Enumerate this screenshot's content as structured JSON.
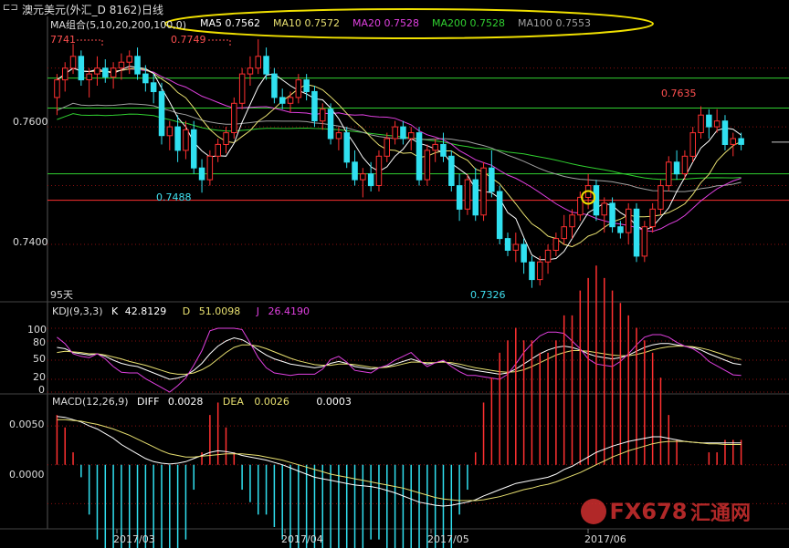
{
  "header": {
    "title": "澳元美元(外汇_D 8162)日线",
    "ma_group_label": "MA组合(5,10,20,200,100,0)",
    "ma_values": [
      {
        "name": "MA5",
        "value": "0.7562",
        "color": "#ffffff"
      },
      {
        "name": "MA10",
        "value": "0.7572",
        "color": "#e8e070"
      },
      {
        "name": "MA20",
        "value": "0.7528",
        "color": "#e040e0"
      },
      {
        "name": "MA200",
        "value": "0.7528",
        "color": "#30d030"
      },
      {
        "name": "MA100",
        "value": "0.7553",
        "color": "#a0a0a0"
      }
    ]
  },
  "annotations": {
    "high1": "7741",
    "high2": "0.7749",
    "low1": "0.7488",
    "low2": "0.7326",
    "high3": "0.7635",
    "days": "95天"
  },
  "kdj": {
    "label": "KDJ(9,3,3)",
    "k_label": "K",
    "k_value": "42.8129",
    "d_label": "D",
    "d_value": "51.0098",
    "j_label": "J",
    "j_value": "26.4190",
    "ticks": [
      "100",
      "80",
      "50",
      "20",
      "0"
    ]
  },
  "macd": {
    "label": "MACD(12,26,9)",
    "diff_label": "DIFF",
    "diff_value": "0.0028",
    "dea_label": "DEA",
    "dea_value": "0.0026",
    "macd_value": "0.0003",
    "ticks": [
      "0.0050",
      "0.0000"
    ]
  },
  "price_axis": {
    "ticks": [
      "0.7600",
      "0.7400"
    ]
  },
  "time_axis": {
    "labels": [
      "2017/03",
      "2017/04",
      "2017/05",
      "2017/06"
    ]
  },
  "watermark": {
    "text": "FX678",
    "text2": "汇通网"
  },
  "colors": {
    "up": "#ff3030",
    "down": "#30e0f0",
    "ma5": "#ffffff",
    "ma10": "#e8e070",
    "ma20": "#e040e0",
    "ma200": "#30d030",
    "ma100": "#a0a0a0",
    "hline": "#30d030",
    "grid_red": "#8a1010"
  },
  "chart_data": [
    {
      "type": "candlestick",
      "title": "澳元美元(外汇_D 8162)日线",
      "ylim": [
        0.731,
        0.776
      ],
      "yticks": [
        0.74,
        0.76
      ],
      "x_labels": [
        "2017/03",
        "2017/04",
        "2017/05",
        "2017/06"
      ],
      "candles": [
        [
          0.765,
          0.769,
          0.762,
          0.768
        ],
        [
          0.768,
          0.771,
          0.766,
          0.77
        ],
        [
          0.77,
          0.7741,
          0.769,
          0.772
        ],
        [
          0.772,
          0.773,
          0.767,
          0.768
        ],
        [
          0.768,
          0.77,
          0.765,
          0.769
        ],
        [
          0.769,
          0.772,
          0.767,
          0.77
        ],
        [
          0.77,
          0.7715,
          0.7675,
          0.7685
        ],
        [
          0.7685,
          0.771,
          0.7665,
          0.77
        ],
        [
          0.77,
          0.7725,
          0.768,
          0.771
        ],
        [
          0.771,
          0.773,
          0.769,
          0.772
        ],
        [
          0.772,
          0.7735,
          0.768,
          0.769
        ],
        [
          0.769,
          0.7705,
          0.766,
          0.7675
        ],
        [
          0.7675,
          0.769,
          0.764,
          0.766
        ],
        [
          0.766,
          0.7675,
          0.757,
          0.7585
        ],
        [
          0.7585,
          0.761,
          0.756,
          0.76
        ],
        [
          0.76,
          0.762,
          0.754,
          0.756
        ],
        [
          0.756,
          0.761,
          0.7545,
          0.7595
        ],
        [
          0.7595,
          0.761,
          0.752,
          0.753
        ],
        [
          0.753,
          0.7545,
          0.7488,
          0.751
        ],
        [
          0.751,
          0.756,
          0.75,
          0.755
        ],
        [
          0.755,
          0.758,
          0.754,
          0.757
        ],
        [
          0.757,
          0.76,
          0.7555,
          0.759
        ],
        [
          0.759,
          0.765,
          0.758,
          0.764
        ],
        [
          0.764,
          0.77,
          0.763,
          0.769
        ],
        [
          0.769,
          0.772,
          0.767,
          0.77
        ],
        [
          0.77,
          0.7749,
          0.769,
          0.772
        ],
        [
          0.772,
          0.7735,
          0.768,
          0.769
        ],
        [
          0.769,
          0.77,
          0.764,
          0.765
        ],
        [
          0.765,
          0.7665,
          0.763,
          0.764
        ],
        [
          0.764,
          0.766,
          0.7625,
          0.765
        ],
        [
          0.765,
          0.769,
          0.764,
          0.768
        ],
        [
          0.768,
          0.769,
          0.7645,
          0.766
        ],
        [
          0.766,
          0.767,
          0.76,
          0.761
        ],
        [
          0.761,
          0.764,
          0.7595,
          0.763
        ],
        [
          0.763,
          0.764,
          0.757,
          0.758
        ],
        [
          0.758,
          0.76,
          0.756,
          0.759
        ],
        [
          0.759,
          0.76,
          0.753,
          0.754
        ],
        [
          0.754,
          0.756,
          0.75,
          0.751
        ],
        [
          0.751,
          0.753,
          0.748,
          0.752
        ],
        [
          0.752,
          0.754,
          0.749,
          0.75
        ],
        [
          0.75,
          0.756,
          0.749,
          0.755
        ],
        [
          0.755,
          0.759,
          0.754,
          0.758
        ],
        [
          0.758,
          0.761,
          0.757,
          0.76
        ],
        [
          0.76,
          0.761,
          0.757,
          0.758
        ],
        [
          0.758,
          0.76,
          0.756,
          0.759
        ],
        [
          0.759,
          0.76,
          0.75,
          0.751
        ],
        [
          0.751,
          0.757,
          0.75,
          0.756
        ],
        [
          0.756,
          0.758,
          0.754,
          0.757
        ],
        [
          0.757,
          0.759,
          0.754,
          0.755
        ],
        [
          0.755,
          0.756,
          0.749,
          0.75
        ],
        [
          0.75,
          0.752,
          0.744,
          0.746
        ],
        [
          0.746,
          0.752,
          0.745,
          0.751
        ],
        [
          0.751,
          0.753,
          0.744,
          0.745
        ],
        [
          0.745,
          0.754,
          0.744,
          0.753
        ],
        [
          0.753,
          0.756,
          0.748,
          0.749
        ],
        [
          0.749,
          0.75,
          0.74,
          0.741
        ],
        [
          0.741,
          0.742,
          0.738,
          0.739
        ],
        [
          0.739,
          0.742,
          0.737,
          0.74
        ],
        [
          0.74,
          0.741,
          0.735,
          0.737
        ],
        [
          0.737,
          0.738,
          0.7326,
          0.734
        ],
        [
          0.734,
          0.738,
          0.733,
          0.737
        ],
        [
          0.737,
          0.74,
          0.735,
          0.739
        ],
        [
          0.739,
          0.742,
          0.738,
          0.741
        ],
        [
          0.741,
          0.745,
          0.74,
          0.743
        ],
        [
          0.743,
          0.746,
          0.741,
          0.745
        ],
        [
          0.745,
          0.749,
          0.744,
          0.748
        ],
        [
          0.748,
          0.752,
          0.746,
          0.75
        ],
        [
          0.75,
          0.751,
          0.744,
          0.745
        ],
        [
          0.745,
          0.748,
          0.742,
          0.747
        ],
        [
          0.747,
          0.748,
          0.742,
          0.743
        ],
        [
          0.743,
          0.744,
          0.741,
          0.742
        ],
        [
          0.742,
          0.747,
          0.74,
          0.746
        ],
        [
          0.746,
          0.747,
          0.737,
          0.738
        ],
        [
          0.738,
          0.744,
          0.737,
          0.743
        ],
        [
          0.743,
          0.747,
          0.742,
          0.746
        ],
        [
          0.746,
          0.751,
          0.745,
          0.75
        ],
        [
          0.75,
          0.755,
          0.749,
          0.754
        ],
        [
          0.754,
          0.756,
          0.751,
          0.752
        ],
        [
          0.752,
          0.756,
          0.751,
          0.755
        ],
        [
          0.755,
          0.76,
          0.754,
          0.759
        ],
        [
          0.759,
          0.7635,
          0.758,
          0.762
        ],
        [
          0.762,
          0.763,
          0.758,
          0.76
        ],
        [
          0.76,
          0.763,
          0.759,
          0.761
        ],
        [
          0.761,
          0.762,
          0.756,
          0.757
        ],
        [
          0.757,
          0.759,
          0.755,
          0.758
        ],
        [
          0.758,
          0.759,
          0.756,
          0.757
        ]
      ]
    },
    {
      "type": "line",
      "title": "KDJ(9,3,3)",
      "ylim": [
        0,
        100
      ],
      "series": [
        {
          "name": "K",
          "values": [
            70,
            68,
            62,
            60,
            58,
            60,
            56,
            50,
            45,
            42,
            40,
            35,
            30,
            25,
            20,
            22,
            26,
            34,
            45,
            60,
            72,
            80,
            85,
            82,
            75,
            66,
            58,
            52,
            48,
            44,
            42,
            40,
            38,
            40,
            45,
            48,
            45,
            40,
            38,
            36,
            38,
            40,
            44,
            48,
            52,
            48,
            44,
            46,
            48,
            44,
            40,
            36,
            34,
            32,
            30,
            28,
            30,
            36,
            44,
            52,
            60,
            66,
            70,
            72,
            70,
            66,
            60,
            56,
            54,
            52,
            54,
            58,
            64,
            70,
            74,
            76,
            76,
            74,
            72,
            70,
            66,
            60,
            55,
            50,
            45,
            43
          ]
        },
        {
          "name": "D",
          "values": [
            62,
            64,
            63,
            62,
            60,
            60,
            58,
            55,
            52,
            48,
            45,
            42,
            38,
            34,
            30,
            28,
            28,
            30,
            35,
            42,
            52,
            62,
            70,
            74,
            74,
            72,
            68,
            63,
            58,
            53,
            49,
            46,
            43,
            42,
            42,
            44,
            44,
            43,
            41,
            39,
            38,
            39,
            41,
            44,
            47,
            47,
            46,
            46,
            47,
            46,
            44,
            41,
            38,
            36,
            34,
            32,
            31,
            32,
            35,
            40,
            46,
            52,
            58,
            62,
            65,
            65,
            64,
            62,
            60,
            58,
            57,
            57,
            59,
            62,
            66,
            69,
            71,
            72,
            72,
            71,
            69,
            66,
            62,
            58,
            54,
            51
          ]
        },
        {
          "name": "J",
          "values": [
            86,
            76,
            60,
            56,
            54,
            60,
            52,
            40,
            31,
            30,
            30,
            21,
            14,
            7,
            0,
            10,
            22,
            42,
            65,
            96,
            100,
            100,
            100,
            98,
            77,
            54,
            38,
            30,
            28,
            26,
            28,
            28,
            28,
            36,
            51,
            56,
            47,
            34,
            32,
            30,
            38,
            42,
            50,
            56,
            62,
            50,
            40,
            46,
            50,
            40,
            32,
            26,
            26,
            24,
            22,
            20,
            28,
            44,
            62,
            76,
            88,
            94,
            94,
            92,
            80,
            68,
            52,
            44,
            42,
            40,
            48,
            60,
            74,
            86,
            90,
            90,
            86,
            78,
            72,
            68,
            60,
            48,
            41,
            34,
            27,
            26
          ]
        }
      ],
      "yticks": [
        0,
        20,
        50,
        80,
        100
      ]
    },
    {
      "type": "bar",
      "title": "MACD(12,26,9)",
      "ylim": [
        -0.008,
        0.007
      ],
      "yticks": [
        0.0,
        0.005
      ],
      "series": [
        {
          "name": "DIFF",
          "values": [
            0.0062,
            0.0061,
            0.0058,
            0.0055,
            0.005,
            0.0046,
            0.004,
            0.0034,
            0.0026,
            0.002,
            0.0014,
            0.0008,
            0.0004,
            0.0002,
            0.0001,
            0.0002,
            0.0004,
            0.0008,
            0.0012,
            0.0016,
            0.0018,
            0.0017,
            0.0015,
            0.0012,
            0.001,
            0.0008,
            0.0006,
            0.0003,
            0.0,
            -0.0004,
            -0.0008,
            -0.0012,
            -0.0016,
            -0.0018,
            -0.002,
            -0.0022,
            -0.0024,
            -0.0026,
            -0.0027,
            -0.0028,
            -0.003,
            -0.0033,
            -0.0036,
            -0.004,
            -0.0044,
            -0.0048,
            -0.005,
            -0.0052,
            -0.0053,
            -0.0052,
            -0.005,
            -0.0048,
            -0.0045,
            -0.004,
            -0.0036,
            -0.0032,
            -0.0028,
            -0.0024,
            -0.0022,
            -0.002,
            -0.0018,
            -0.0016,
            -0.0012,
            -0.0006,
            -0.0002,
            0.0004,
            0.001,
            0.0016,
            0.002,
            0.0024,
            0.0027,
            0.003,
            0.0032,
            0.0034,
            0.0036,
            0.0036,
            0.0034,
            0.0032,
            0.003,
            0.0029,
            0.0028,
            0.0028,
            0.0028,
            0.0028,
            0.0028,
            0.0028
          ]
        },
        {
          "name": "DEA",
          "values": [
            0.0058,
            0.0058,
            0.0057,
            0.0056,
            0.0054,
            0.0052,
            0.0049,
            0.0046,
            0.0042,
            0.0038,
            0.0033,
            0.0028,
            0.0023,
            0.0018,
            0.0014,
            0.0012,
            0.001,
            0.001,
            0.0011,
            0.0012,
            0.0013,
            0.0014,
            0.0014,
            0.0014,
            0.0013,
            0.0012,
            0.001,
            0.0008,
            0.0006,
            0.0003,
            0.0,
            -0.0003,
            -0.0006,
            -0.0009,
            -0.0012,
            -0.0014,
            -0.0016,
            -0.0018,
            -0.002,
            -0.0022,
            -0.0024,
            -0.0026,
            -0.0028,
            -0.003,
            -0.0033,
            -0.0036,
            -0.0039,
            -0.0042,
            -0.0044,
            -0.0045,
            -0.0046,
            -0.0046,
            -0.0046,
            -0.0045,
            -0.0043,
            -0.0041,
            -0.0038,
            -0.0035,
            -0.0032,
            -0.003,
            -0.0027,
            -0.0025,
            -0.0022,
            -0.0018,
            -0.0014,
            -0.001,
            -0.0005,
            0.0,
            0.0005,
            0.001,
            0.0014,
            0.0018,
            0.0021,
            0.0024,
            0.0027,
            0.0029,
            0.003,
            0.003,
            0.003,
            0.0029,
            0.0028,
            0.0027,
            0.0027,
            0.0026,
            0.0026,
            0.0026
          ]
        }
      ]
    }
  ]
}
